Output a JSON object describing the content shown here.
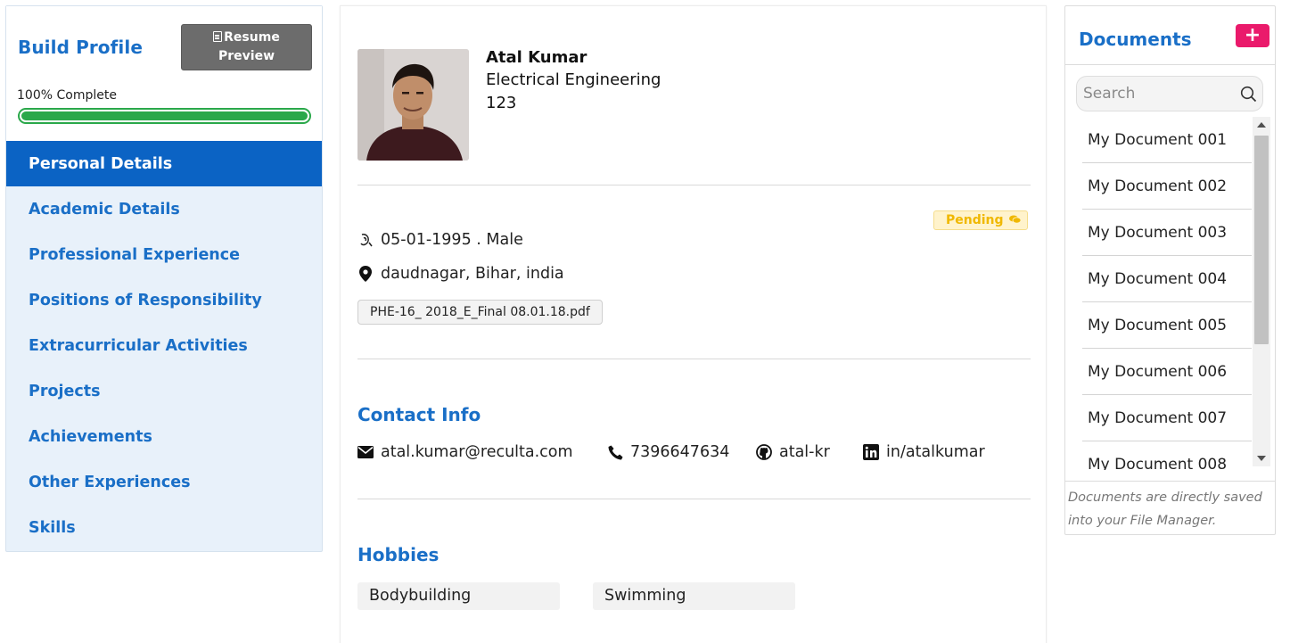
{
  "sidebar": {
    "title": "Build Profile",
    "resume_preview_line1": "Resume",
    "resume_preview_line2": "Preview",
    "progress_label": "100% Complete",
    "progress_percent": 100,
    "progress_color": "#2aa84a",
    "items": [
      {
        "label": "Personal Details",
        "active": true
      },
      {
        "label": "Academic Details"
      },
      {
        "label": "Professional Experience"
      },
      {
        "label": "Positions of Responsibility"
      },
      {
        "label": "Extracurricular Activities"
      },
      {
        "label": "Projects"
      },
      {
        "label": "Achievements"
      },
      {
        "label": "Other Experiences"
      },
      {
        "label": "Skills"
      }
    ]
  },
  "profile": {
    "name": "Atal Kumar",
    "department": "Electrical Engineering",
    "roll": "123",
    "status": "Pending",
    "dob_gender": "05-01-1995 . Male",
    "location": "daudnagar, Bihar, india",
    "attachment": "PHE-16_ 2018_E_Final 08.01.18.pdf"
  },
  "contact": {
    "title": "Contact Info",
    "email": "atal.kumar@reculta.com",
    "phone": "7396647634",
    "github": "atal-kr",
    "linkedin": "in/atalkumar"
  },
  "hobbies": {
    "title": "Hobbies",
    "items": [
      "Bodybuilding",
      "Swimming"
    ]
  },
  "documents": {
    "title": "Documents",
    "add_label": "+",
    "search_placeholder": "Search",
    "items": [
      "My Document 001",
      "My Document 002",
      "My Document 003",
      "My Document 004",
      "My Document 005",
      "My Document 006",
      "My Document 007",
      "My Document 008"
    ],
    "note": "Documents are directly saved into your File Manager."
  },
  "colors": {
    "accent": "#1a6fc7",
    "active_nav": "#0b63c4",
    "pending": "#f0b800",
    "add_button": "#ea1a6b"
  }
}
